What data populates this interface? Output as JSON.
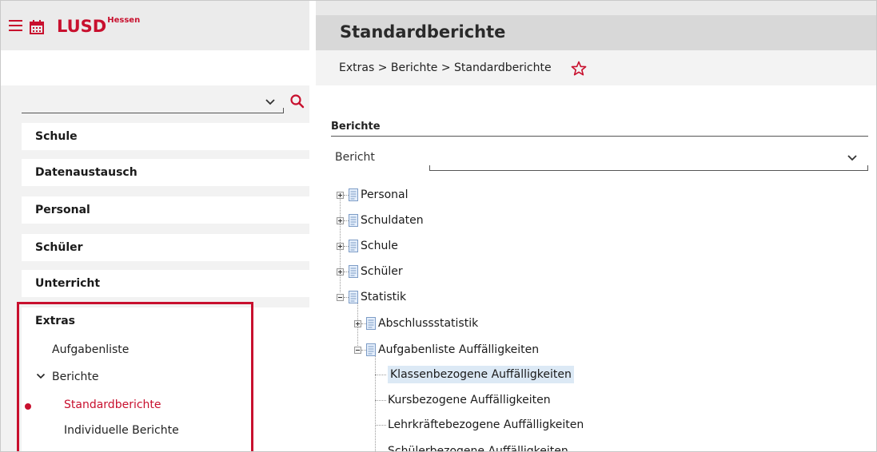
{
  "header": {
    "logo_text": "LUSD",
    "logo_sup": "Hessen",
    "page_title": "Standardberichte",
    "brand_color": "#c8102e"
  },
  "breadcrumb": {
    "text": "Extras > Berichte > Standardberichte",
    "favorite_icon": "star-outline-icon"
  },
  "sidebar": {
    "search": {
      "value": "",
      "placeholder": ""
    },
    "nav": [
      {
        "label": "Schule"
      },
      {
        "label": "Datenaustausch"
      },
      {
        "label": "Personal"
      },
      {
        "label": "Schüler"
      },
      {
        "label": "Unterricht"
      },
      {
        "label": "Extras"
      }
    ],
    "extras_children": {
      "aufgabenliste": "Aufgabenliste",
      "berichte": "Berichte",
      "standardberichte": "Standardberichte",
      "individuelle": "Individuelle Berichte"
    }
  },
  "main": {
    "section_title": "Berichte",
    "select_label": "Bericht",
    "tree": [
      {
        "label": "Personal",
        "level": 0,
        "state": "collapsed"
      },
      {
        "label": "Schuldaten",
        "level": 0,
        "state": "collapsed"
      },
      {
        "label": "Schule",
        "level": 0,
        "state": "collapsed"
      },
      {
        "label": "Schüler",
        "level": 0,
        "state": "collapsed"
      },
      {
        "label": "Statistik",
        "level": 0,
        "state": "expanded"
      },
      {
        "label": "Abschlussstatistik",
        "level": 1,
        "state": "collapsed"
      },
      {
        "label": "Aufgabenliste Auffälligkeiten",
        "level": 1,
        "state": "expanded"
      },
      {
        "label": "Klassenbezogene Auffälligkeiten",
        "level": 2,
        "state": "leaf",
        "selected": true
      },
      {
        "label": "Kursbezogene Auffälligkeiten",
        "level": 2,
        "state": "leaf"
      },
      {
        "label": "Lehrkräftebezogene Auffälligkeiten",
        "level": 2,
        "state": "leaf"
      },
      {
        "label": "Schülerbezogene Auffälligkeiten",
        "level": 2,
        "state": "leaf"
      }
    ]
  }
}
